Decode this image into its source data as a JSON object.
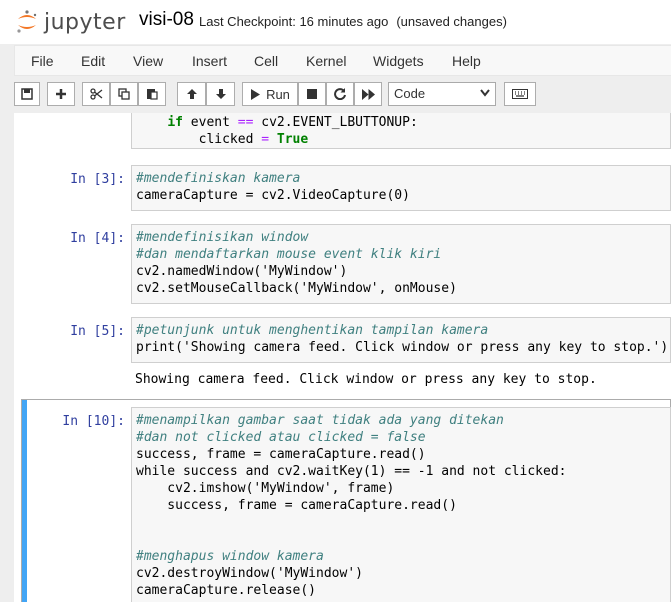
{
  "header": {
    "logo_text": "jupyter",
    "notebook_name": "visi-08",
    "checkpoint": "Last Checkpoint: 16 minutes ago",
    "unsaved": "(unsaved changes)"
  },
  "menu": [
    "File",
    "Edit",
    "View",
    "Insert",
    "Cell",
    "Kernel",
    "Widgets",
    "Help"
  ],
  "toolbar": {
    "run_label": "Run",
    "cell_type": "Code",
    "icons": [
      "save-icon",
      "plus-icon",
      "cut-icon",
      "copy-icon",
      "paste-icon",
      "arrow-up-icon",
      "arrow-down-icon",
      "play-icon",
      "stop-icon",
      "restart-icon",
      "fast-forward-icon",
      "keyboard-icon"
    ]
  },
  "cells": {
    "c0": {
      "lines": [
        "    if event == cv2.EVENT_LBUTTONUP:",
        "        clicked = True"
      ]
    },
    "c3": {
      "prompt": "In [3]:",
      "comment": "#mendefiniskan kamera",
      "code": "cameraCapture = cv2.VideoCapture(0)"
    },
    "c4": {
      "prompt": "In [4]:",
      "comment1": "#mendefinisikan window",
      "comment2": "#dan mendaftarkan mouse event klik kiri",
      "code1": "cv2.namedWindow('MyWindow')",
      "code2": "cv2.setMouseCallback('MyWindow', onMouse)"
    },
    "c5": {
      "prompt": "In [5]:",
      "comment": "#petunjunk untuk menghentikan tampilan kamera",
      "code": "print('Showing camera feed. Click window or press any key to stop.')",
      "output": "Showing camera feed. Click window or press any key to stop."
    },
    "c10": {
      "prompt": "In [10]:",
      "comment1": "#menampilkan gambar saat tidak ada yang ditekan",
      "comment2": "#dan not clicked atau clicked = false",
      "code1": "success, frame = cameraCapture.read()",
      "code2": "while success and cv2.waitKey(1) == -1 and not clicked:",
      "code3": "    cv2.imshow('MyWindow', frame)",
      "code4": "    success, frame = cameraCapture.read()",
      "comment3": "#menghapus window kamera",
      "code5": "cv2.destroyWindow('MyWindow')",
      "code6": "cameraCapture.release()"
    }
  },
  "colors": {
    "prompt": "#303f9f",
    "selected": "#42a5f5",
    "comment": "#408080",
    "keyword": "#008000",
    "string": "#ba2121"
  }
}
